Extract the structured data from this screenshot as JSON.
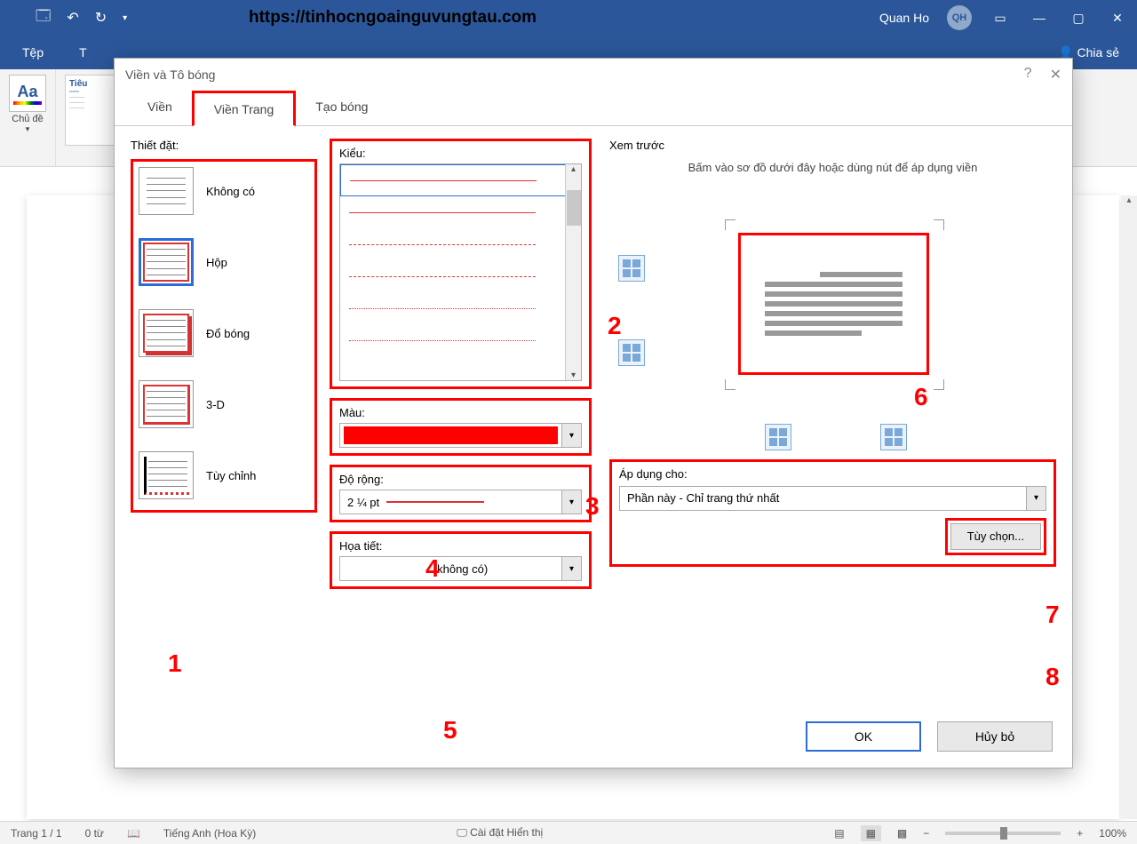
{
  "titlebar": {
    "url_overlay": "https://tinhocngoainguvungtau.com",
    "user_name": "Quan Ho",
    "user_initials": "QH"
  },
  "ribbon": {
    "file_tab": "Tệp",
    "share": "Chia sẻ",
    "themes_group": "Chủ đề",
    "title_style": "Tiêu"
  },
  "dialog": {
    "title": "Viền và Tô bóng",
    "tabs": {
      "borders": "Viền",
      "page_border": "Viền Trang",
      "shading": "Tạo bóng"
    },
    "settings_label": "Thiết đặt:",
    "settings": {
      "none": "Không có",
      "box": "Hộp",
      "shadow": "Đổ bóng",
      "threeD": "3-D",
      "custom": "Tùy chỉnh"
    },
    "style_label": "Kiểu:",
    "color_label": "Màu:",
    "color_value": "#ff0000",
    "width_label": "Độ rộng:",
    "width_value": "2 ¼ pt",
    "art_label": "Họa tiết:",
    "art_value": "(không có)",
    "preview_label": "Xem trước",
    "preview_hint": "Bấm vào sơ đồ dưới đây hoặc dùng nút để áp dụng viền",
    "apply_label": "Áp dụng cho:",
    "apply_value": "Phần này - Chỉ trang thứ nhất",
    "options_btn": "Tùy chọn...",
    "ok": "OK",
    "cancel": "Hủy bỏ"
  },
  "annotations": {
    "a1": "1",
    "a2": "2",
    "a3": "3",
    "a4": "4",
    "a5": "5",
    "a6": "6",
    "a7": "7",
    "a8": "8"
  },
  "statusbar": {
    "page": "Trang 1 / 1",
    "words": "0 từ",
    "language": "Tiếng Anh (Hoa Kỳ)",
    "display_settings": "Cài đặt Hiển thị",
    "zoom": "100%"
  }
}
